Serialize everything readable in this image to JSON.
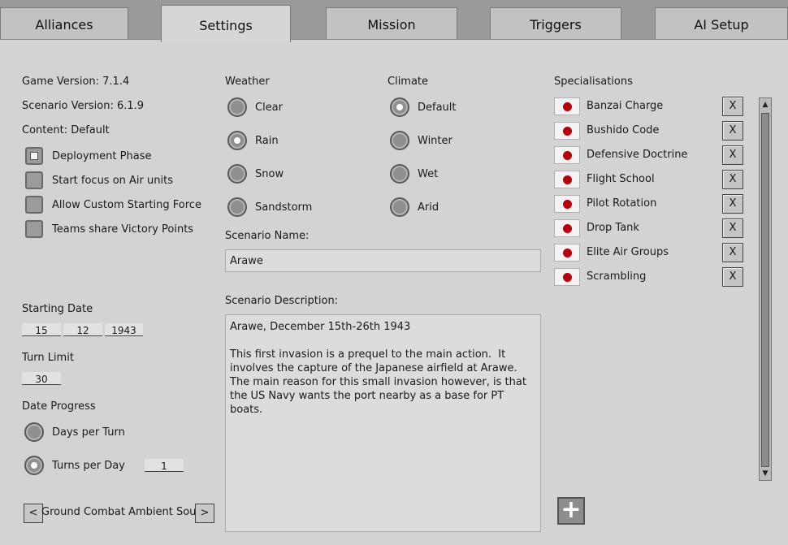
{
  "tabs": [
    "Alliances",
    "Settings",
    "Mission",
    "Triggers",
    "AI Setup"
  ],
  "left": {
    "game_version": "Game Version: 7.1.4",
    "scenario_version": "Scenario Version: 6.1.9",
    "content": "Content: Default",
    "options": [
      {
        "label": "Deployment Phase",
        "checked": true
      },
      {
        "label": "Start focus on Air units",
        "checked": false
      },
      {
        "label": "Allow Custom Starting Force",
        "checked": false
      },
      {
        "label": "Teams share Victory Points",
        "checked": false
      }
    ],
    "starting_date_label": "Starting Date",
    "date": {
      "day": "15",
      "month": "12",
      "year": "1943"
    },
    "turn_limit_label": "Turn Limit",
    "turn_limit": "30",
    "date_progress_label": "Date Progress",
    "progress_days": "Days per Turn",
    "progress_turns": "Turns per Day",
    "turns_per_day_value": "1",
    "sound_selector": "Ground Combat Ambient Sound",
    "prev": "<",
    "next": ">"
  },
  "weather": {
    "label": "Weather",
    "options": [
      "Clear",
      "Rain",
      "Snow",
      "Sandstorm"
    ],
    "selected": "Rain"
  },
  "climate": {
    "label": "Climate",
    "options": [
      "Default",
      "Winter",
      "Wet",
      "Arid"
    ],
    "selected": "Default"
  },
  "scenario": {
    "name_label": "Scenario Name:",
    "name": "Arawe",
    "description_label": "Scenario Description:",
    "description": "Arawe, December 15th-26th 1943\n\nThis first invasion is a prequel to the main action.  It involves the capture of the Japanese airfield at Arawe. The main reason for this small invasion however, is that the US Navy wants the port nearby as a base for PT boats."
  },
  "specialisations": {
    "label": "Specialisations",
    "remove_label": "X",
    "add_label": "+",
    "items": [
      "Banzai Charge",
      "Bushido Code",
      "Defensive Doctrine",
      "Flight School",
      "Pilot Rotation",
      "Drop Tank",
      "Elite Air Groups",
      "Scrambling"
    ]
  },
  "colors": {
    "flag_red": "#b3000c",
    "panel": "#d3d3d3"
  }
}
